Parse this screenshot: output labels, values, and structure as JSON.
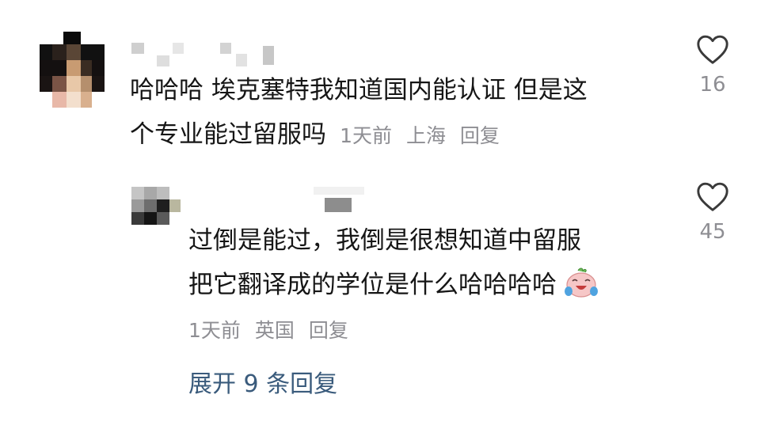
{
  "comment": {
    "text_line1": "哈哈哈 埃克塞特我知道国内能认证 但是这",
    "text_line2": "个专业能过留服吗",
    "time": "1天前",
    "location": "上海",
    "reply_label": "回复",
    "like_count": "16",
    "avatar_icon": "pixelated-avatar",
    "like_icon": "heart-outline-icon"
  },
  "reply": {
    "text_line1": "过倒是能过，我倒是很想知道中留服",
    "text_line2": "把它翻译成的学位是什么哈哈哈哈",
    "emoji_icon": "laughing-crying-emoji-icon",
    "time": "1天前",
    "location": "英国",
    "reply_label": "回复",
    "like_count": "45",
    "avatar_icon": "pixelated-avatar",
    "like_icon": "heart-outline-icon"
  },
  "expand_label": "展开 9 条回复",
  "colors": {
    "text": "#161616",
    "meta": "#8e8e93",
    "link": "#3a5b7c"
  }
}
